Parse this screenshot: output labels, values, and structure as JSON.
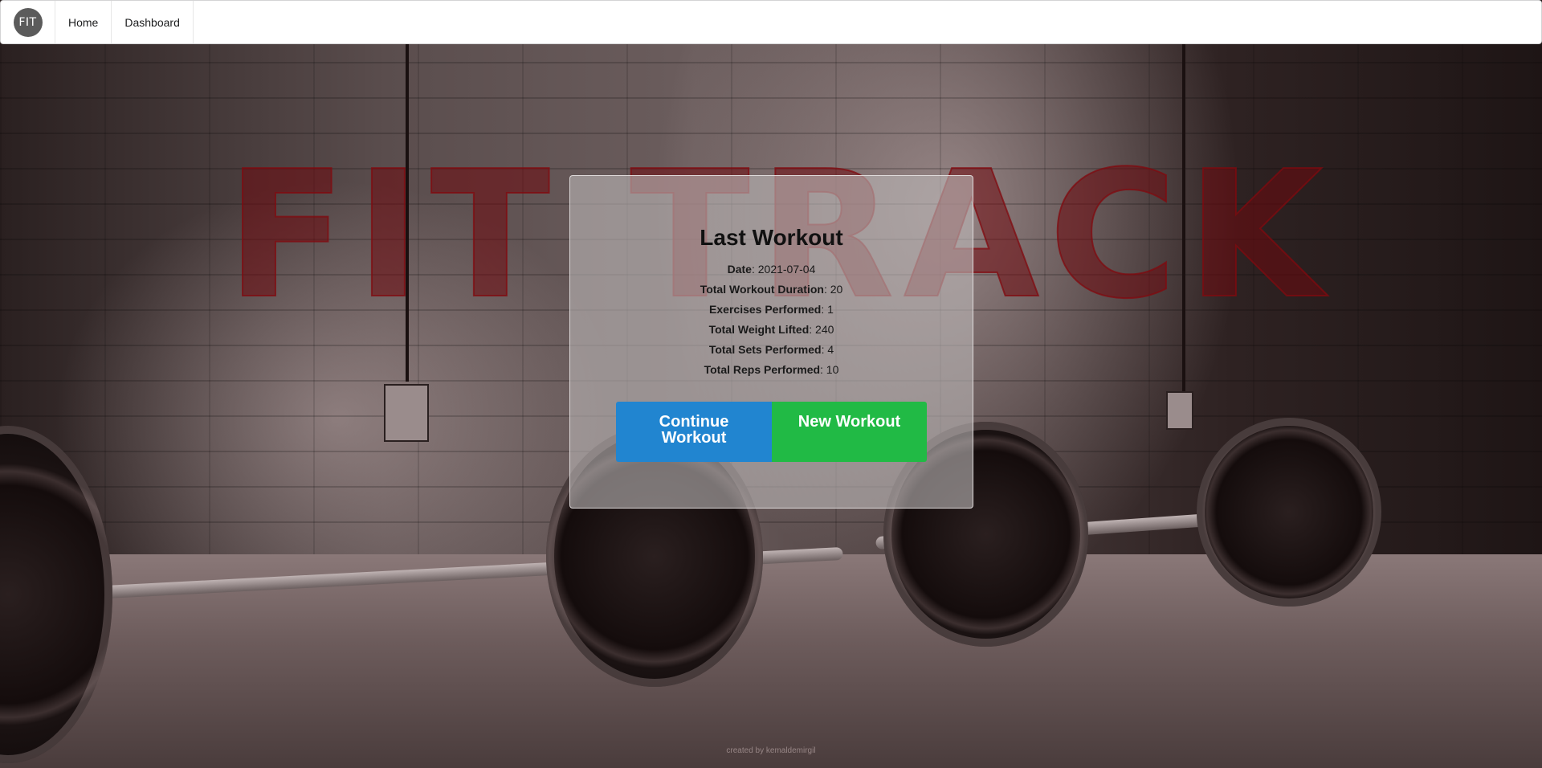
{
  "nav": {
    "logo_text": "FIT",
    "items": [
      {
        "label": "Home"
      },
      {
        "label": "Dashboard"
      }
    ]
  },
  "hero": {
    "title": "FIT TRACK"
  },
  "last_workout": {
    "title": "Last Workout",
    "stats": [
      {
        "label": "Date",
        "value": ": 2021-07-04"
      },
      {
        "label": "Total Workout Duration",
        "value": ": 20"
      },
      {
        "label": "Exercises Performed",
        "value": ": 1"
      },
      {
        "label": "Total Weight Lifted",
        "value": ": 240"
      },
      {
        "label": "Total Sets Performed",
        "value": ": 4"
      },
      {
        "label": "Total Reps Performed",
        "value": ": 10"
      }
    ],
    "buttons": {
      "continue_line1": "Continue",
      "continue_line2": "Workout",
      "new": "New Workout"
    }
  },
  "footer": {
    "text": "created by kemaldemirgil"
  },
  "colors": {
    "continue_button": "#2185d0",
    "new_button": "#21ba45",
    "hero_title": "#6e0a0f"
  }
}
